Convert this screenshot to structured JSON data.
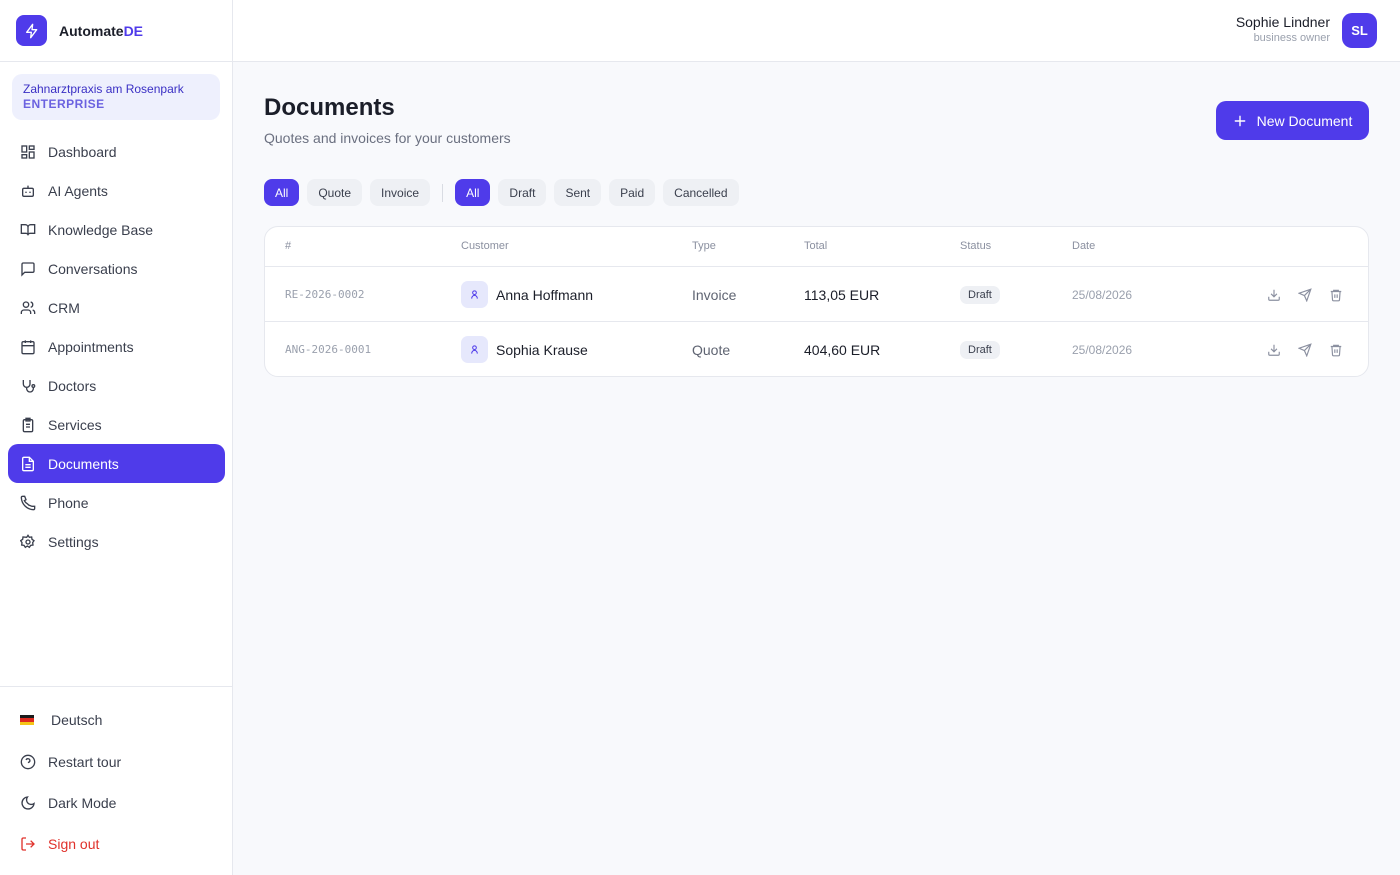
{
  "brand": {
    "name": "Automate",
    "accent": "DE"
  },
  "org": {
    "name": "Zahnarztpraxis am Rosenpark",
    "plan": "ENTERPRISE"
  },
  "nav": [
    {
      "label": "Dashboard",
      "icon": "dashboard-icon"
    },
    {
      "label": "AI Agents",
      "icon": "bot-icon"
    },
    {
      "label": "Knowledge Base",
      "icon": "book-icon"
    },
    {
      "label": "Conversations",
      "icon": "message-icon"
    },
    {
      "label": "CRM",
      "icon": "users-icon"
    },
    {
      "label": "Appointments",
      "icon": "calendar-icon"
    },
    {
      "label": "Doctors",
      "icon": "stethoscope-icon"
    },
    {
      "label": "Services",
      "icon": "clipboard-icon"
    },
    {
      "label": "Documents",
      "icon": "document-icon",
      "active": true
    },
    {
      "label": "Phone",
      "icon": "phone-icon"
    },
    {
      "label": "Settings",
      "icon": "gear-icon"
    }
  ],
  "bottom": {
    "language": "Deutsch",
    "restart_tour": "Restart tour",
    "dark_mode": "Dark Mode",
    "sign_out": "Sign out"
  },
  "user": {
    "name": "Sophie Lindner",
    "role": "business owner",
    "initials": "SL"
  },
  "page": {
    "title": "Documents",
    "subtitle": "Quotes and invoices for your customers",
    "new_button": "New Document"
  },
  "filters": {
    "type": [
      "All",
      "Quote",
      "Invoice"
    ],
    "status": [
      "All",
      "Draft",
      "Sent",
      "Paid",
      "Cancelled"
    ]
  },
  "table": {
    "headers": [
      "#",
      "Customer",
      "Type",
      "Total",
      "Status",
      "Date"
    ],
    "rows": [
      {
        "number": "RE-2026-0002",
        "customer": "Anna Hoffmann",
        "type": "Invoice",
        "total": "113,05 EUR",
        "status": "Draft",
        "date": "25/08/2026"
      },
      {
        "number": "ANG-2026-0001",
        "customer": "Sophia Krause",
        "type": "Quote",
        "total": "404,60 EUR",
        "status": "Draft",
        "date": "25/08/2026"
      }
    ]
  },
  "colors": {
    "accent": "#4f3bea",
    "danger": "#e0312b"
  }
}
